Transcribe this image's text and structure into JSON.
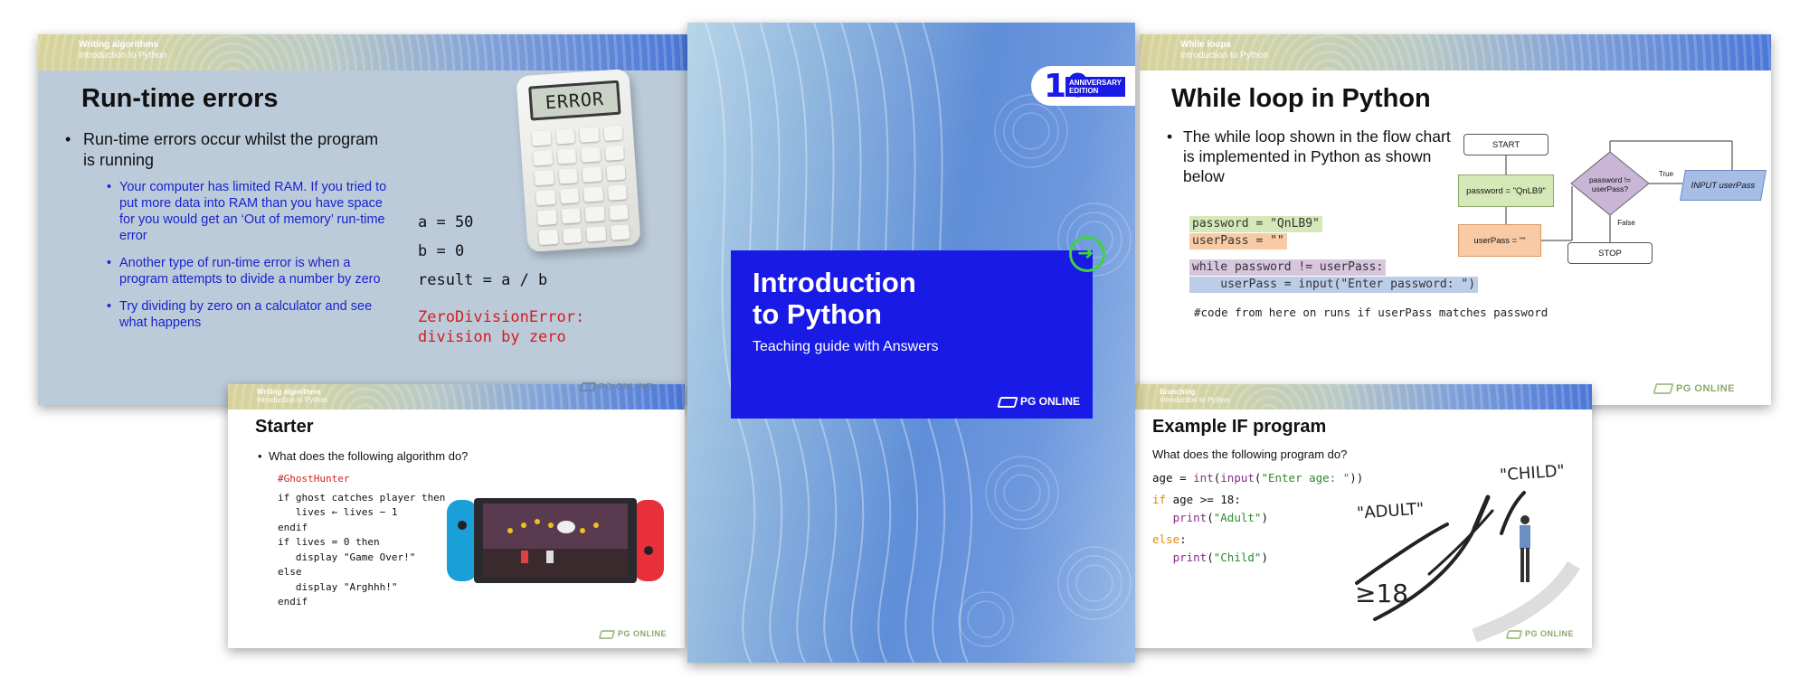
{
  "slide_run_time": {
    "section": "Writing algorithms",
    "subsection": "Introduction to Python",
    "title": "Run-time errors",
    "main_bullet": "Run-time errors occur whilst the program is running",
    "sub_bullets": [
      "Your computer has limited RAM. If you tried to put more data into RAM than you have space for you would get an ‘Out of memory’ run-time error",
      "Another type of run-time error is when a program attempts to divide a number by zero",
      "Try dividing by zero on a calculator and see what happens"
    ],
    "code": [
      "a = 50",
      "b = 0",
      "result = a / b"
    ],
    "error_lines": [
      "ZeroDivisionError:",
      "division by zero"
    ],
    "calculator_display": "ERROR",
    "logo": "PG ONLINE"
  },
  "slide_while": {
    "section": "While loops",
    "subsection": "Introduction to Python",
    "title": "While loop in Python",
    "main_bullet": "The while loop shown in the flow chart is implemented in Python as shown below",
    "code_line1": "password = \"QnLB9\"",
    "code_line2": "userPass = \"\"",
    "code_line3": "while password != userPass:",
    "code_line4": "    userPass = input(\"Enter password: \")",
    "comment": "#code from here on runs if userPass matches password",
    "flowchart": {
      "start": "START",
      "assign_pw": "password = \"QnLB9\"",
      "assign_up": "userPass = \"\"",
      "decision": "password != userPass?",
      "true_label": "True",
      "false_label": "False",
      "input": "INPUT userPass",
      "stop": "STOP"
    },
    "logo": "PG ONLINE"
  },
  "slide_starter": {
    "section": "Writing algorithms",
    "subsection": "Introduction to Python",
    "title": "Starter",
    "bullet": "What does the following algorithm do?",
    "pseudo_title": "#GhostHunter",
    "pseudo_lines": [
      "if ghost catches player then",
      "   lives ← lives − 1",
      "endif",
      "if lives = 0 then",
      "   display \"Game Over!\"",
      "else",
      "   display \"Arghhh!\"",
      "endif"
    ],
    "logo": "PG ONLINE"
  },
  "slide_if": {
    "section": "Branching",
    "subsection": "Introduction to Python",
    "title": "Example IF program",
    "question": "What does the following program do?",
    "handwriting_child": "\"CHILD\"",
    "handwriting_adult": "\"ADULT\"",
    "handwriting_cond": "≥18",
    "logo": "PG ONLINE"
  },
  "book": {
    "title_line1": "Introduction",
    "title_line2": "to Python",
    "subtitle": "Teaching guide with Answers",
    "publisher": "PG ONLINE",
    "anniversary_number": "10",
    "anniversary_label_1": "ANNIVERSARY",
    "anniversary_label_2": "EDITION"
  }
}
